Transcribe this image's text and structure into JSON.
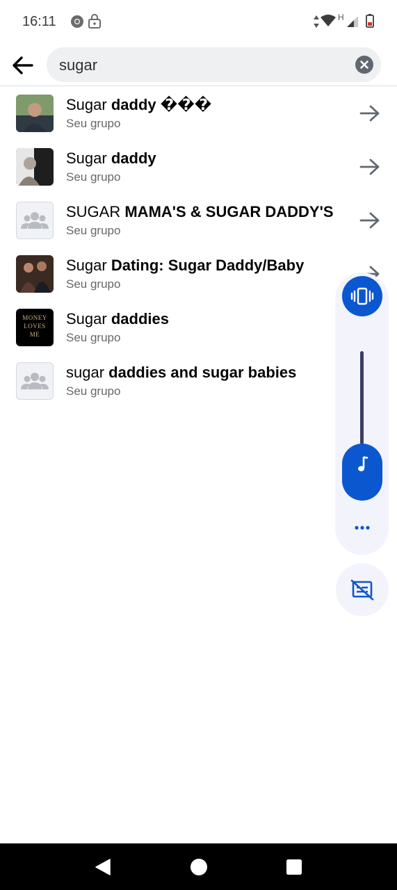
{
  "status_bar": {
    "time": "16:11",
    "network_label": "H",
    "icons": [
      "chrome-icon",
      "lock-icon",
      "data-arrows-icon",
      "wifi-icon",
      "signal-icon",
      "battery-icon"
    ]
  },
  "search": {
    "query": "sugar",
    "placeholder": ""
  },
  "results": [
    {
      "normal": "Sugar ",
      "bold": "daddy ���",
      "subtitle": "Seu grupo",
      "thumb": "photo"
    },
    {
      "normal": "Sugar ",
      "bold": "daddy",
      "subtitle": "Seu grupo",
      "thumb": "photo"
    },
    {
      "normal": "SUGAR ",
      "bold": "MAMA'S & SUGAR DADDY'S",
      "subtitle": "Seu grupo",
      "thumb": "group-placeholder"
    },
    {
      "normal": "Sugar ",
      "bold": "Dating: Sugar Daddy/Baby",
      "subtitle": "Seu grupo",
      "thumb": "photo"
    },
    {
      "normal": "Sugar ",
      "bold": "daddies",
      "subtitle": "Seu grupo",
      "thumb": "money-loves-me",
      "thumb_text": "MONEY LOVES ME"
    },
    {
      "normal": "sugar ",
      "bold": "daddies and sugar babies",
      "subtitle": "Seu grupo",
      "thumb": "group-placeholder"
    }
  ],
  "volume_panel": {
    "icons": [
      "vibrate-icon",
      "music-note-icon",
      "more-icon",
      "captions-off-icon"
    ],
    "accent_color": "#0b57d0"
  },
  "nav_bar": {
    "buttons": [
      "back-triangle-icon",
      "home-circle-icon",
      "recents-square-icon"
    ]
  }
}
